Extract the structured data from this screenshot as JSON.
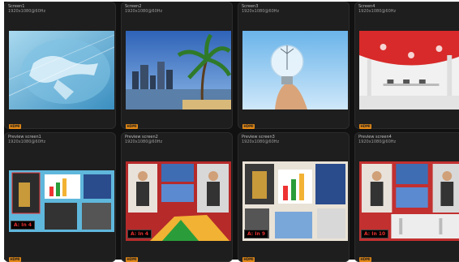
{
  "screens": [
    {
      "title": "Screen1",
      "subtitle": "1920x1080@60Hz",
      "badge": "HDMI"
    },
    {
      "title": "Screen2",
      "subtitle": "1920x1080@60Hz",
      "badge": "HDMI"
    },
    {
      "title": "Screen3",
      "subtitle": "1920x1080@60Hz",
      "badge": "HDMI"
    },
    {
      "title": "Screen4",
      "subtitle": "1920x1080@60Hz",
      "badge": "HDMI"
    }
  ],
  "previews": [
    {
      "title": "Preview screen1",
      "subtitle": "1920x1080@60Hz",
      "tag": "A: In 4",
      "badge": "HDMI"
    },
    {
      "title": "Preview screen2",
      "subtitle": "1920x1080@60Hz",
      "tag": "A: In 4",
      "badge": "HDMI"
    },
    {
      "title": "Preview screen3",
      "subtitle": "1920x1080@60Hz",
      "tag": "A: In 9",
      "badge": "HDMI"
    },
    {
      "title": "Preview screen4",
      "subtitle": "1920x1080@60Hz",
      "tag": "A: In 10",
      "badge": "HDMI"
    }
  ],
  "thumbnails": [
    "world-map-image",
    "city-palm-image",
    "lightbulb-image",
    "office-interior-image"
  ]
}
